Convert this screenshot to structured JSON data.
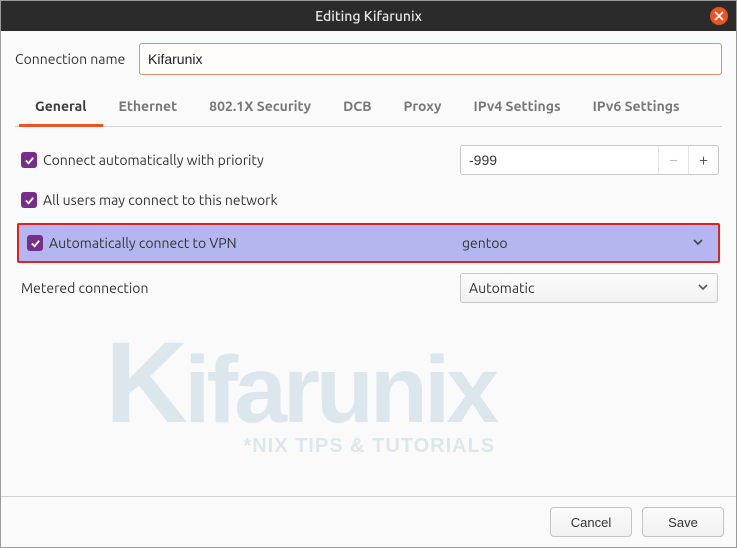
{
  "window": {
    "title": "Editing Kifarunix"
  },
  "connection": {
    "label": "Connection name",
    "value": "Kifarunix"
  },
  "tabs": {
    "general": "General",
    "ethernet": "Ethernet",
    "security": "802.1X Security",
    "dcb": "DCB",
    "proxy": "Proxy",
    "ipv4": "IPv4 Settings",
    "ipv6": "IPv6 Settings"
  },
  "general": {
    "auto_priority": {
      "label": "Connect automatically with priority",
      "value": "-999"
    },
    "all_users": {
      "label": "All users may connect to this network"
    },
    "auto_vpn": {
      "label": "Automatically connect to VPN",
      "value": "gentoo"
    },
    "metered": {
      "label": "Metered connection",
      "value": "Automatic"
    }
  },
  "footer": {
    "cancel": "Cancel",
    "save": "Save"
  },
  "watermark": {
    "main": "Kifarunix",
    "sub": "*NIX TIPS & TUTORIALS"
  }
}
